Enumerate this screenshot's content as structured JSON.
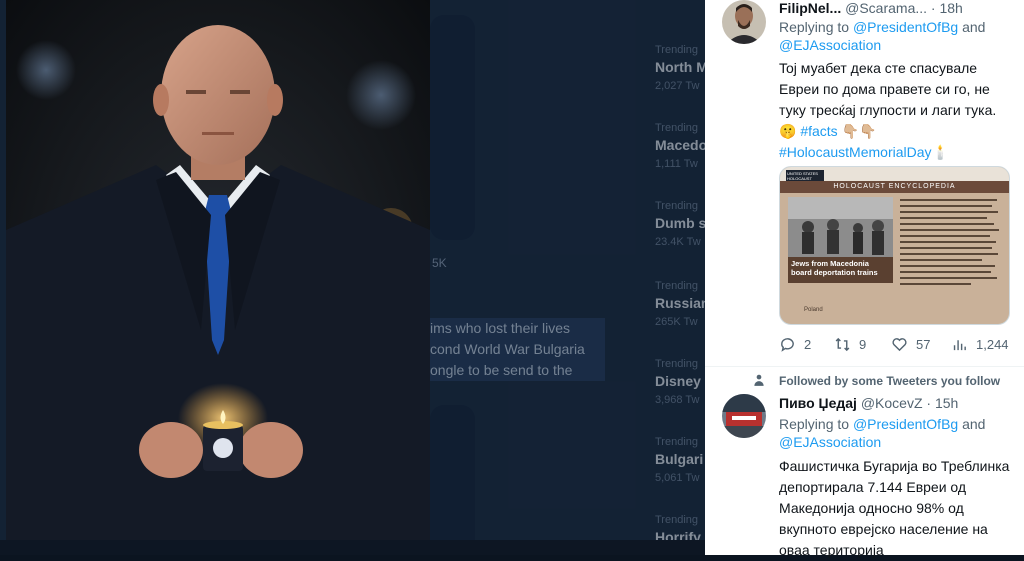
{
  "background": {
    "trends": [
      {
        "category": "Trending",
        "name": "North M",
        "count": "2,027 Tw"
      },
      {
        "category": "Trending",
        "name": "Macedo",
        "count": "1,111 Tw"
      },
      {
        "category": "Trending",
        "name": "Dumb s",
        "count": "23.4K Tw"
      },
      {
        "category": "Trending",
        "name": "Russian",
        "count": "265K Tw"
      },
      {
        "category": "Trending",
        "name": "Disney",
        "count": "3,968 Tw"
      },
      {
        "category": "Trending",
        "name": "Bulgari",
        "count": "5,061 Tw"
      },
      {
        "category": "Trending",
        "name": "Horrify",
        "count": ""
      }
    ],
    "partial_count": "5K",
    "partial_text": [
      "ims who lost their lives",
      "cond World War Bulgaria",
      "ongle to be send to the"
    ]
  },
  "tweet1": {
    "name": "FilipNel...",
    "handle": "@Scarama...",
    "dot": "·",
    "time": "18h",
    "replying_prefix": "Replying to ",
    "mention1": "@PresidentOfBg",
    "and": " and",
    "mention2": "@EJAssociation",
    "text": "Toj муабет дека сте спасувале Евреи по дома правете си го, не туку тресќај глупости и лаги тука.",
    "emoji1": "🤫",
    "hashtag1": "#facts",
    "emoji2": "👇🏼👇🏼",
    "hashtag2": "#HolocaustMemorialDay",
    "emoji3": "🕯️",
    "media": {
      "logo": "UNITED STATES HOLOCAUST MEMORIAL MUSEUM",
      "banner": "HOLOCAUST ENCYCLOPEDIA",
      "caption": "Jews from Macedonia board deportation trains",
      "footer": "Poland"
    },
    "replies": "2",
    "retweets": "9",
    "likes": "57",
    "views": "1,244"
  },
  "tweet2": {
    "followed_note": "Followed by some Tweeters you follow",
    "name": "Пиво Џедај",
    "handle": "@KocevZ",
    "dot": "·",
    "time": "15h",
    "replying_prefix": "Replying to ",
    "mention1": "@PresidentOfBg",
    "and": " and",
    "mention2": "@EJAssociation",
    "text": "Фашистичка Бугарија во Треблинка депортирала 7.144 Евреи од Македонија односно 98% од вкупното еврејско население на оваа територија"
  },
  "colors": {
    "accent": "#1d9bf0",
    "text": "#0f1419",
    "muted": "#536471"
  }
}
